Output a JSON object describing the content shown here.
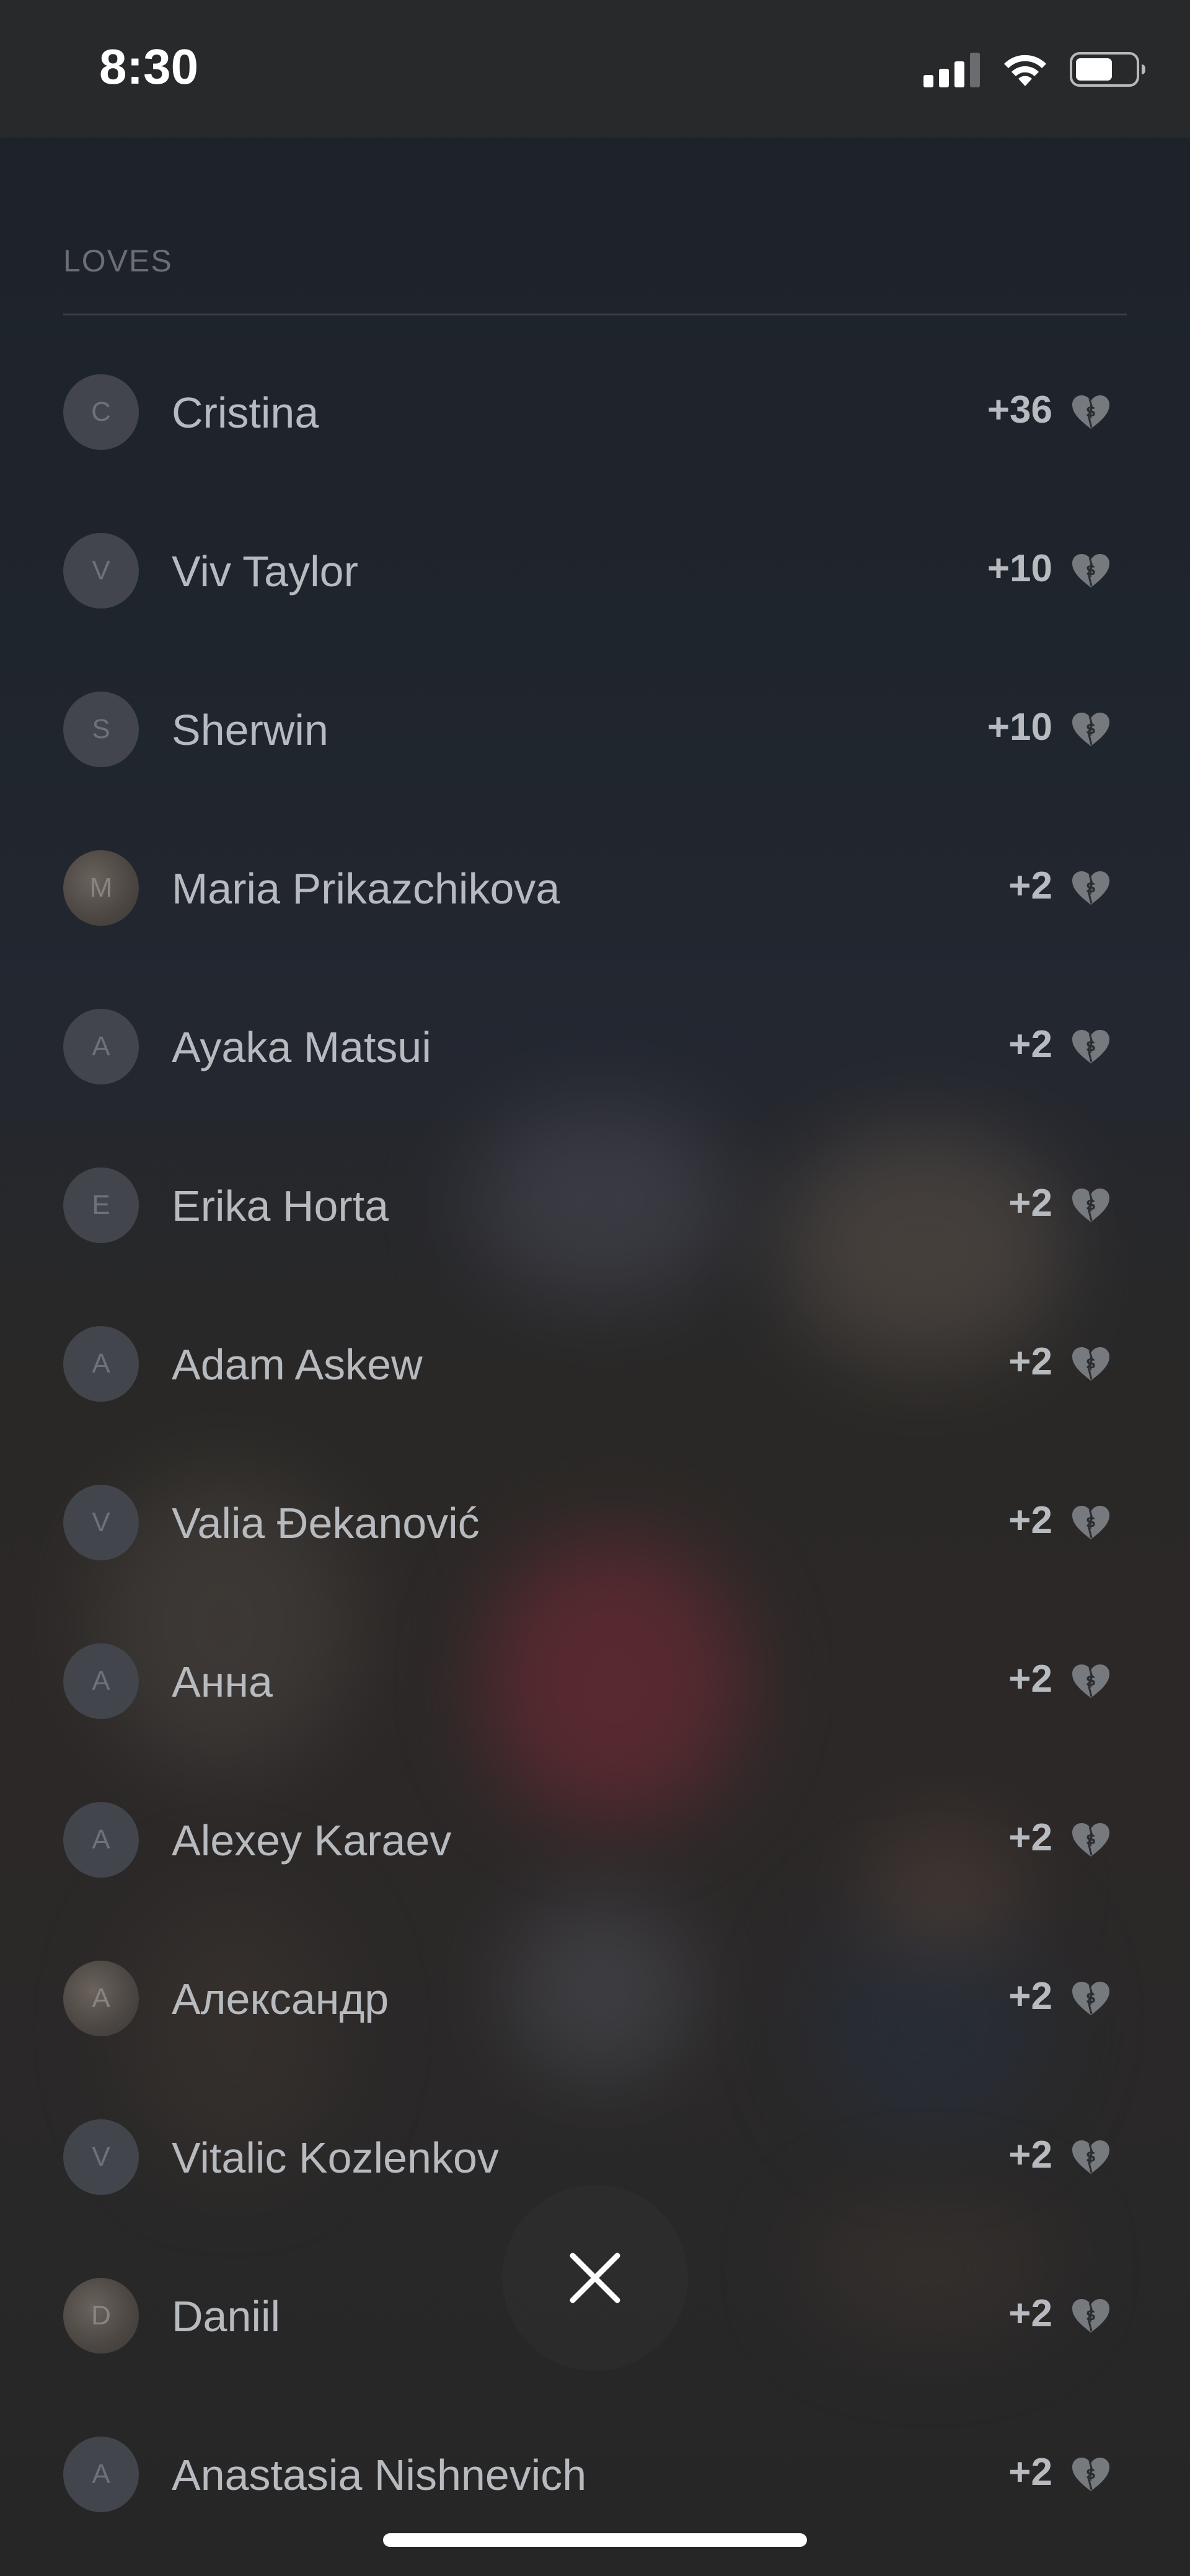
{
  "status": {
    "time": "8:30"
  },
  "section": {
    "title": "LOVES"
  },
  "items": [
    {
      "initial": "C",
      "name": "Cristina",
      "count": "+36"
    },
    {
      "initial": "V",
      "name": "Viv Taylor",
      "count": "+10"
    },
    {
      "initial": "S",
      "name": "Sherwin",
      "count": "+10"
    },
    {
      "initial": "M",
      "name": "Maria Prikazchikova",
      "count": "+2"
    },
    {
      "initial": "A",
      "name": "Ayaka Matsui",
      "count": "+2"
    },
    {
      "initial": "E",
      "name": "Erika Horta",
      "count": "+2"
    },
    {
      "initial": "A",
      "name": "Adam Askew",
      "count": "+2"
    },
    {
      "initial": "V",
      "name": "Valia Đekanović",
      "count": "+2"
    },
    {
      "initial": "A",
      "name": "Анна",
      "count": "+2"
    },
    {
      "initial": "A",
      "name": "Alexey Karaev",
      "count": "+2"
    },
    {
      "initial": "A",
      "name": "Александр",
      "count": "+2"
    },
    {
      "initial": "V",
      "name": "Vitalic Kozlenkov",
      "count": "+2"
    },
    {
      "initial": "D",
      "name": "Daniil",
      "count": "+2"
    },
    {
      "initial": "A",
      "name": "Anastasia Nishnevich",
      "count": "+2"
    }
  ],
  "icons": {
    "row_icon": "broken-dollar-heart-icon",
    "close": "close-icon"
  },
  "colors": {
    "background": "#232526",
    "text": "#b7babe",
    "header": "#6b6f75"
  }
}
